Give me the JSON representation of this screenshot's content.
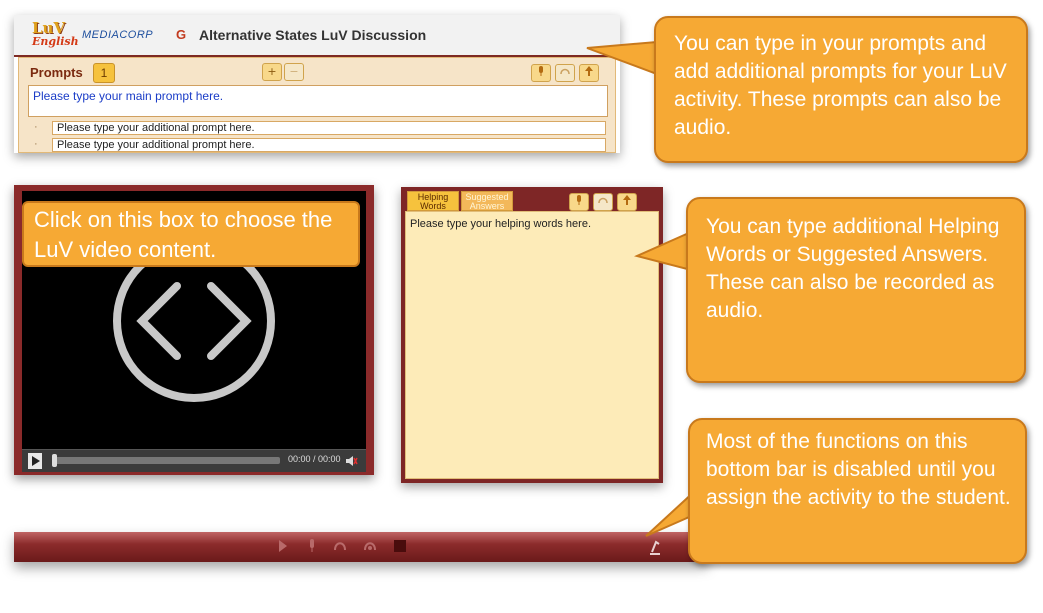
{
  "app": {
    "logo_luv": "LuV",
    "logo_english": "English",
    "logo_mediacorp": "MEDIACORP",
    "title_icon": "G",
    "title": "Alternative States LuV Discussion"
  },
  "prompts": {
    "label": "Prompts",
    "count": "1",
    "add_btn": "+",
    "remove_btn": "−",
    "main_prompt": "Please type your main prompt here.",
    "additional": [
      "Please type your additional prompt here.",
      "Please type your additional prompt here."
    ],
    "icons": [
      "mic-icon",
      "listen-icon",
      "upload-icon"
    ]
  },
  "video": {
    "time": "00:00 / 00:00",
    "callout": "Click on this box to choose the LuV video content."
  },
  "helping": {
    "tab_helping": "Helping Words",
    "tab_suggested": "Suggested Answers",
    "text": "Please type your helping words here."
  },
  "bottom_bar": {
    "icons": [
      "play-icon",
      "mic-icon",
      "listen-icon",
      "rewind-icon",
      "stop-icon",
      "settings-icon"
    ]
  },
  "callouts": {
    "prompts": "You can type in your prompts and add additional prompts for your LuV activity. These prompts can also be audio.",
    "helping": "You can type additional Helping Words or Suggested Answers. These can also be recorded as audio.",
    "bottom": "Most of the functions on this bottom bar is disabled until you assign the activity to the student."
  },
  "colors": {
    "accent": "#f6a934",
    "panel_dark": "#7e2626",
    "prompt_blue": "#1a3cc7"
  }
}
